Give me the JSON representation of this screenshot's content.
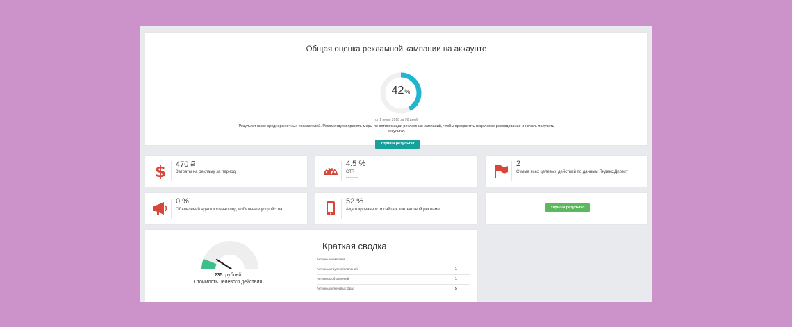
{
  "overall": {
    "title": "Общая оценка рекламной кампании на аккаунте",
    "score": "42",
    "score_unit": "%",
    "score_value": 42,
    "period": "от 1 июня 2018 за 90 дней",
    "description": "Результат ниже среднерыночных показателей. Рекомендуем принять меры по оптимизации рекламных кампаний, чтобы прекратить нецелевое расходование и начать получать результат.",
    "button_label": "Улучши результат"
  },
  "metrics": [
    {
      "icon": "dollar-icon",
      "value": "470 ₽",
      "label": "Затраты на рекламу за период",
      "sub": ""
    },
    {
      "icon": "speedometer-icon",
      "value": "4.5 %",
      "label": "CTR",
      "sub": "на поиске"
    },
    {
      "icon": "flag-icon",
      "value": "2",
      "label": "Сумма всех целевых действий по данным Яндекс.Директ",
      "sub": ""
    },
    {
      "icon": "megaphone-icon",
      "value": "0 %",
      "label": "Объявлений адаптировано под мобильные устройства",
      "sub": ""
    },
    {
      "icon": "mobile-phone-icon",
      "value": "52 %",
      "label": "Адаптированности сайта к контекстной рекламе",
      "sub": ""
    }
  ],
  "improve_button_label": "Улучши результат",
  "summary": {
    "cpa_value": "235",
    "cpa_unit": "рублей",
    "cpa_label": "Стоимость целевого действия",
    "title": "Краткая сводка",
    "rows": [
      {
        "label": "Активных кампаний",
        "value": "1"
      },
      {
        "label": "Активных групп объявлений",
        "value": "1"
      },
      {
        "label": "Активных объявлений",
        "value": "1"
      },
      {
        "label": "Активных ключевых фраз",
        "value": "5"
      }
    ]
  },
  "colors": {
    "page_bg": "#cb93c9",
    "accent_teal": "#19a09b",
    "donut_cyan": "#22b5d0",
    "icon_red": "#d6473a",
    "button_green": "#5cb85c",
    "gauge_green": "#3dbf8a"
  }
}
